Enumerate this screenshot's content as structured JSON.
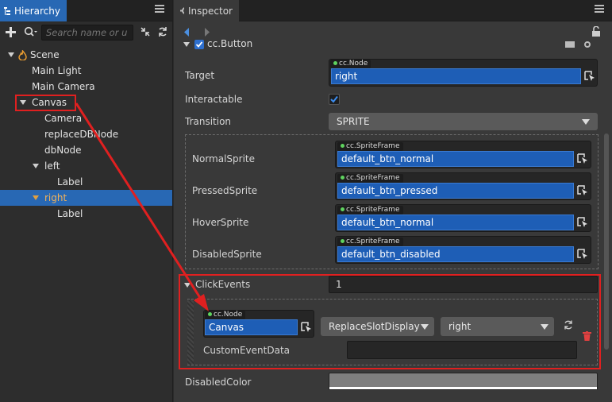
{
  "hierarchy": {
    "tab_label": "Hierarchy",
    "search_placeholder": "Search name or u",
    "tree": [
      {
        "label": "Scene"
      },
      {
        "label": "Main Light"
      },
      {
        "label": "Main Camera"
      },
      {
        "label": "Canvas"
      },
      {
        "label": "Camera"
      },
      {
        "label": "replaceDBNode"
      },
      {
        "label": "dbNode"
      },
      {
        "label": "left"
      },
      {
        "label": "Label"
      },
      {
        "label": "right"
      },
      {
        "label": "Label"
      }
    ]
  },
  "inspector": {
    "tab_label": "Inspector",
    "component_name": "cc.Button",
    "target": {
      "label": "Target",
      "type_tag": "cc.Node",
      "value": "right"
    },
    "interactable": {
      "label": "Interactable",
      "checked": true
    },
    "transition": {
      "label": "Transition",
      "value": "SPRITE"
    },
    "sprites": [
      {
        "label": "NormalSprite",
        "type_tag": "cc.SpriteFrame",
        "value": "default_btn_normal"
      },
      {
        "label": "PressedSprite",
        "type_tag": "cc.SpriteFrame",
        "value": "default_btn_pressed"
      },
      {
        "label": "HoverSprite",
        "type_tag": "cc.SpriteFrame",
        "value": "default_btn_normal"
      },
      {
        "label": "DisabledSprite",
        "type_tag": "cc.SpriteFrame",
        "value": "default_btn_disabled"
      }
    ],
    "click_events": {
      "label": "ClickEvents",
      "count": "1",
      "target_tag": "cc.Node",
      "target_value": "Canvas",
      "component": "ReplaceSlotDisplay",
      "handler": "right",
      "custom_data_label": "CustomEventData",
      "custom_data_value": ""
    },
    "disabled_color": {
      "label": "DisabledColor",
      "color": "#7f7f7f"
    }
  },
  "colors": {
    "accent": "#2868b4",
    "field_blue": "#1e5eb6",
    "annotation_red": "#e02020"
  }
}
